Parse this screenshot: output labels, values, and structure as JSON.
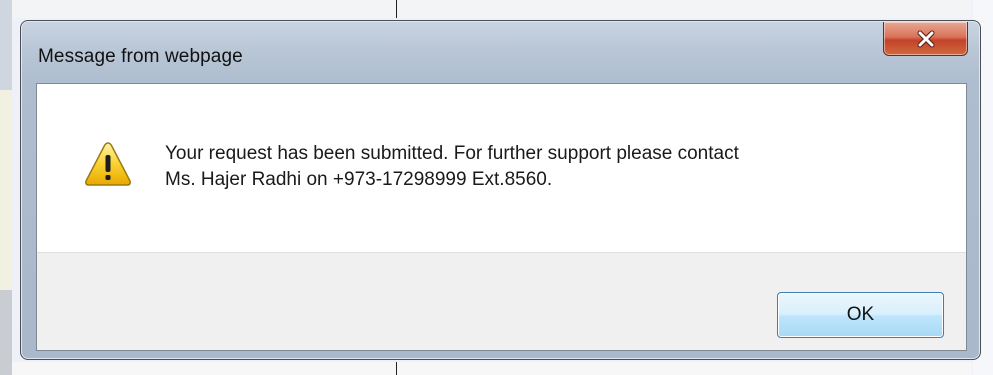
{
  "dialog": {
    "title": "Message from webpage",
    "message_lines": [
      "Your request has been submitted. For further support please contact",
      "Ms. Hajer Radhi on +973-17298999 Ext.8560."
    ],
    "ok_label": "OK",
    "icon": "warning-icon"
  },
  "colors": {
    "close_button": "#c7492e",
    "ok_border": "#3c7fb1",
    "warning_fill": "#f6c300"
  }
}
